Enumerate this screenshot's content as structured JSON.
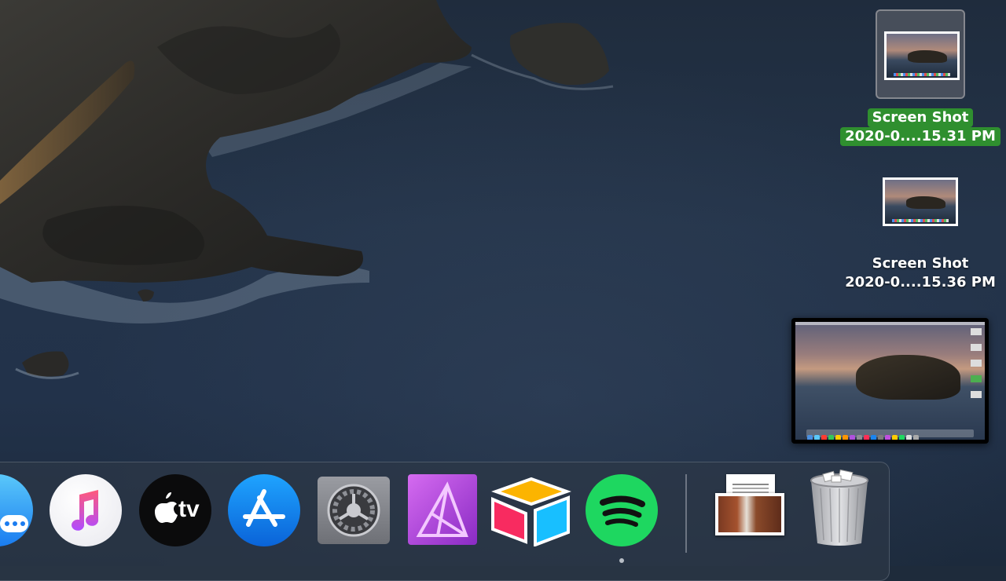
{
  "desktop": {
    "icons": [
      {
        "label_line1": "Screen Shot",
        "label_line2": "2020-0....15.31 PM",
        "selected": true
      },
      {
        "label_line1": "Screen Shot",
        "label_line2": "2020-0....15.36 PM",
        "selected": false
      }
    ]
  },
  "dock": {
    "apps": [
      {
        "name": "Messages",
        "icon": "messages-icon"
      },
      {
        "name": "Music",
        "icon": "music-icon"
      },
      {
        "name": "Apple TV",
        "icon": "apple-tv-icon",
        "text": "tv"
      },
      {
        "name": "App Store",
        "icon": "app-store-icon"
      },
      {
        "name": "System Preferences",
        "icon": "system-preferences-icon"
      },
      {
        "name": "Affinity Photo",
        "icon": "affinity-photo-icon"
      },
      {
        "name": "Airtable",
        "icon": "airtable-icon"
      },
      {
        "name": "Spotify",
        "icon": "spotify-icon",
        "running": true
      }
    ],
    "stack": {
      "name": "Downloads",
      "icon": "downloads-stack-icon"
    },
    "trash": {
      "name": "Trash",
      "icon": "trash-icon"
    }
  },
  "colors": {
    "selection_label": "#2f8f2f",
    "spotify": "#1ed760",
    "app_store": "#1a84f0"
  }
}
